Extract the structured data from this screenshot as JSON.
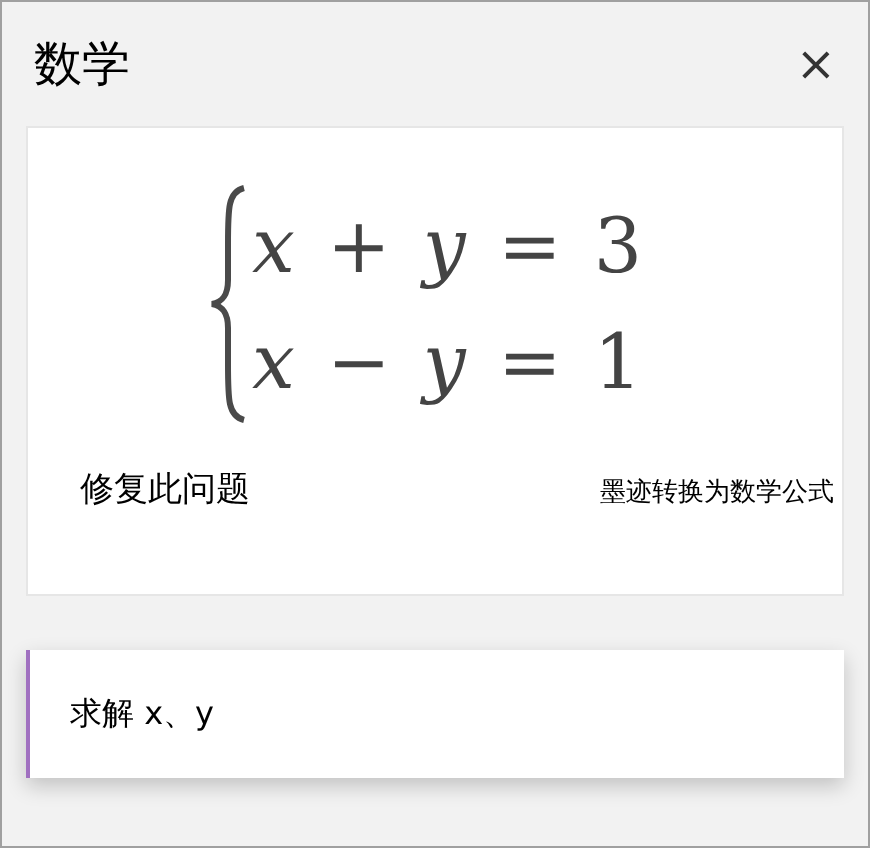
{
  "panel": {
    "title": "数学",
    "close": "×"
  },
  "equation": {
    "lines": [
      "*x* + *y* = 3",
      "*x* − *y* = 1"
    ]
  },
  "actions": [
    "修复此问题",
    "墨迹转换为数学公式"
  ],
  "solve_field": {
    "value": "求解 x、y"
  }
}
